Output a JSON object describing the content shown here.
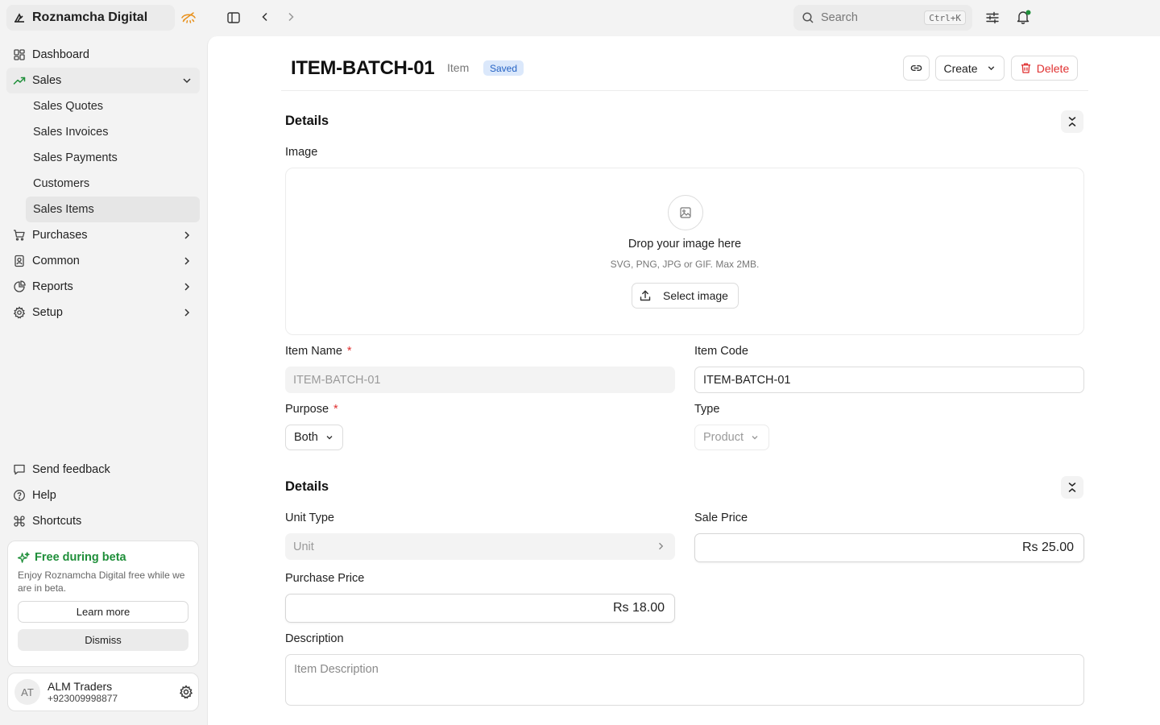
{
  "app": {
    "name": "Roznamcha Digital"
  },
  "topbar": {
    "search_placeholder": "Search",
    "search_shortcut": "Ctrl+K"
  },
  "sidebar": {
    "items": [
      {
        "label": "Dashboard",
        "icon": "dashboard-grid-icon"
      },
      {
        "label": "Sales",
        "icon": "trending-up-icon",
        "expanded": true
      },
      {
        "label": "Purchases",
        "icon": "cart-icon"
      },
      {
        "label": "Common",
        "icon": "contacts-book-icon"
      },
      {
        "label": "Reports",
        "icon": "pie-chart-icon"
      },
      {
        "label": "Setup",
        "icon": "gear-icon"
      }
    ],
    "sales_sub_items": [
      "Sales Quotes",
      "Sales Invoices",
      "Sales Payments",
      "Customers",
      "Sales Items"
    ],
    "active_sub_item": "Sales Items",
    "footer_links": [
      {
        "label": "Send feedback",
        "icon": "message-icon"
      },
      {
        "label": "Help",
        "icon": "help-circle-icon"
      },
      {
        "label": "Shortcuts",
        "icon": "command-icon"
      }
    ],
    "beta": {
      "title": "Free during beta",
      "text": "Enjoy Roznamcha Digital free while we are in beta.",
      "learn_more": "Learn more",
      "dismiss": "Dismiss"
    },
    "account": {
      "initials": "AT",
      "name": "ALM Traders",
      "phone": "+923009998877"
    }
  },
  "doc": {
    "title": "ITEM-BATCH-01",
    "type": "Item",
    "status": "Saved",
    "create_label": "Create",
    "delete_label": "Delete"
  },
  "section1": {
    "title": "Details",
    "image_label": "Image",
    "drop_title": "Drop your image here",
    "drop_sub": "SVG, PNG, JPG or GIF. Max 2MB.",
    "select_image": "Select image",
    "item_name_label": "Item Name",
    "item_name_value": "ITEM-BATCH-01",
    "item_code_label": "Item Code",
    "item_code_value": "ITEM-BATCH-01",
    "purpose_label": "Purpose",
    "purpose_value": "Both",
    "type_label": "Type",
    "type_value": "Product",
    "required_mark": "*"
  },
  "section2": {
    "title": "Details",
    "unit_type_label": "Unit Type",
    "unit_type_placeholder": "Unit",
    "sale_price_label": "Sale Price",
    "sale_price_value": "Rs 25.00",
    "purchase_price_label": "Purchase Price",
    "purchase_price_value": "Rs 18.00",
    "description_label": "Description",
    "description_placeholder": "Item Description"
  },
  "colors": {
    "accent_green": "#1f8f3a",
    "danger_red": "#e03131",
    "saved_badge_bg": "#dbe8fb",
    "saved_badge_text": "#2563c4",
    "brand_hide_orange": "#e8911c"
  }
}
